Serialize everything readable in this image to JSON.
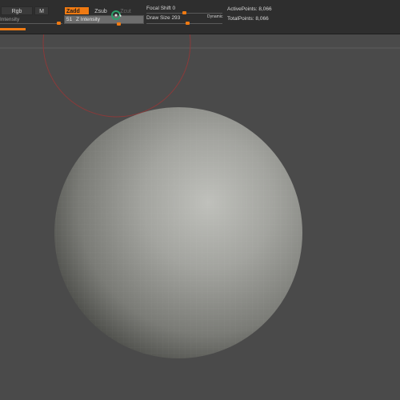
{
  "toolbar": {
    "rgb_label": "Rgb",
    "m_label": "M",
    "zadd_label": "Zadd",
    "zsub_label": "Zsub",
    "zcut_label": "Zcut",
    "intensity_label": "Intensity",
    "z_intensity_label": "Z Intensity",
    "z_intensity_value": "51",
    "focal_shift_label": "Focal Shift",
    "focal_shift_value": "0",
    "draw_size_label": "Draw Size",
    "draw_size_value": "293",
    "dynamic_label": "Dynamic",
    "active_points_label": "ActivePoints:",
    "active_points_value": "8,066",
    "total_points_label": "TotalPoints:",
    "total_points_value": "8,066"
  },
  "colors": {
    "accent": "#f07a12",
    "brush_circle": "#8a3a3a",
    "background": "#4a4a4a",
    "toolbar": "#2e2e2e"
  },
  "icons": {
    "brush_cursor": "brush-cursor-icon"
  }
}
